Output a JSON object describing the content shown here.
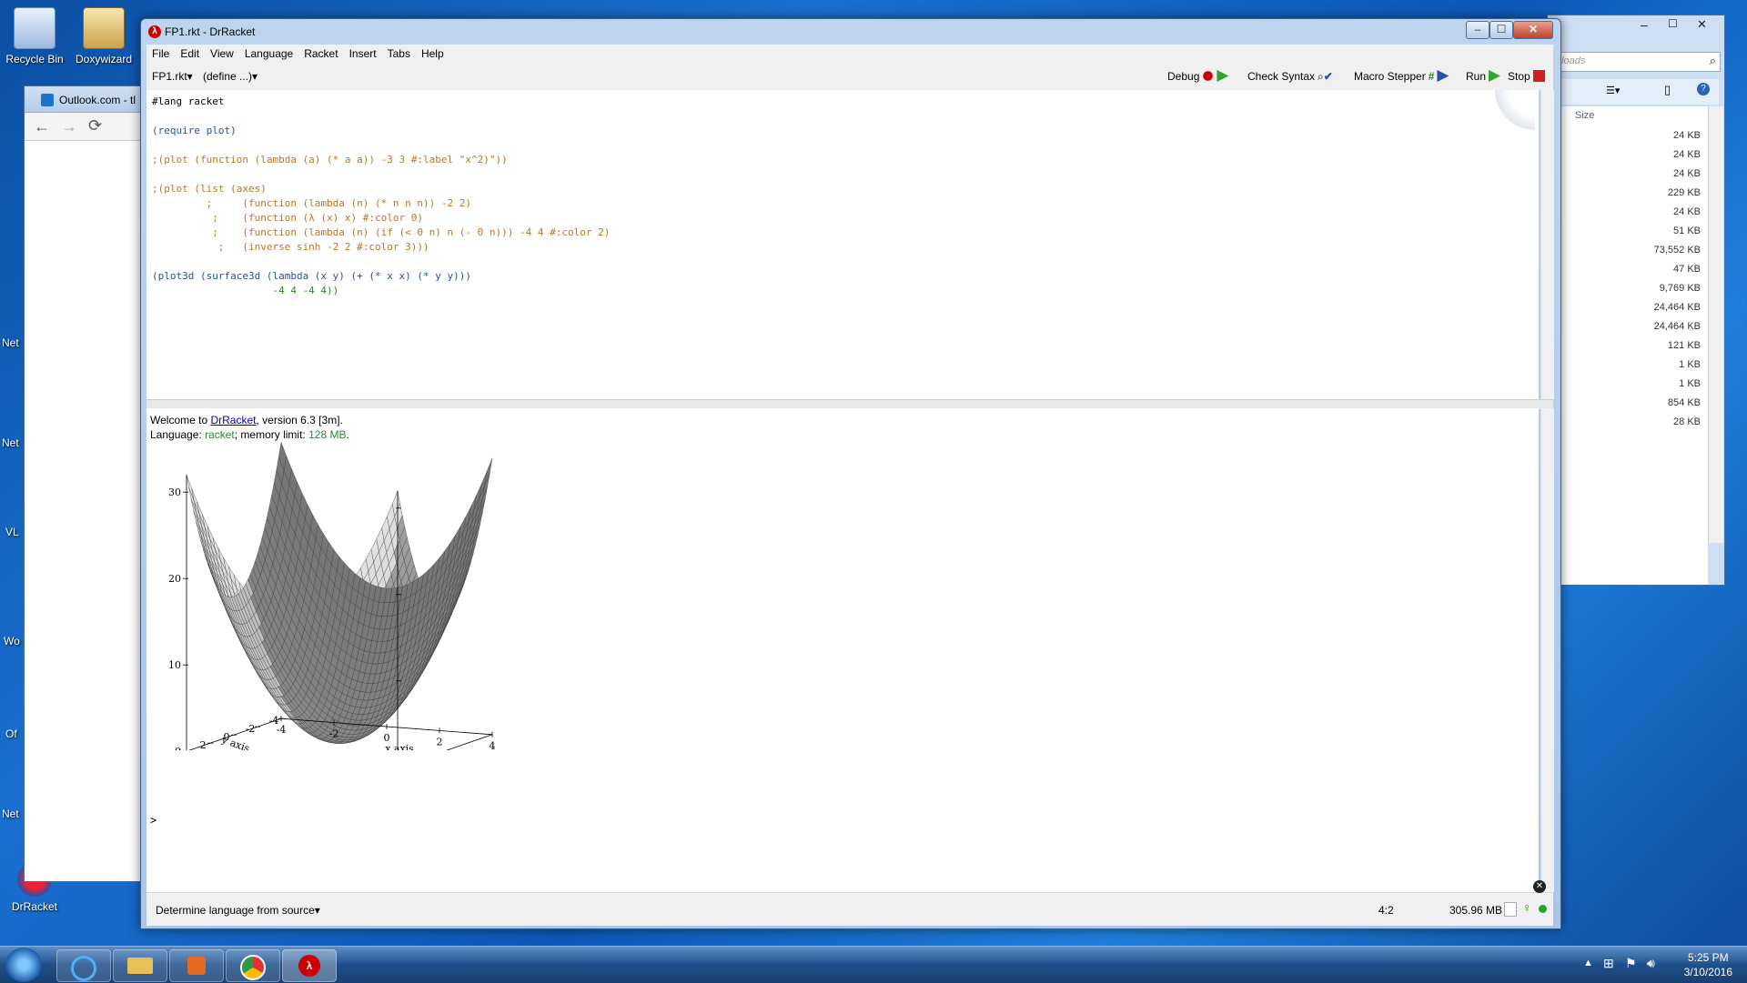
{
  "desktop_icons": [
    {
      "label": "Recycle Bin"
    },
    {
      "label": "Doxywizard"
    },
    {
      "label": "DrRacket"
    }
  ],
  "left_fragments": [
    "Net",
    "Net",
    "VL",
    "Wo",
    "Of",
    "Net"
  ],
  "browser": {
    "tab_title": "Outlook.com - tl"
  },
  "explorer": {
    "search_placeholder": "nloads",
    "size_header": "Size",
    "sizes": [
      "24 KB",
      "24 KB",
      "24 KB",
      "229 KB",
      "24 KB",
      "51 KB",
      "73,552 KB",
      "47 KB",
      "9,769 KB",
      "24,464 KB",
      "24,464 KB",
      "121 KB",
      "1 KB",
      "1 KB",
      "854 KB",
      "28 KB"
    ]
  },
  "window": {
    "title": "FP1.rkt - DrRacket",
    "min": "–",
    "max": "☐",
    "close": "✕"
  },
  "menu": [
    "File",
    "Edit",
    "View",
    "Language",
    "Racket",
    "Insert",
    "Tabs",
    "Help"
  ],
  "toolbar": {
    "file_dropdown": "FP1.rkt",
    "define_dropdown": "(define ...)",
    "debug": "Debug",
    "check_syntax": "Check Syntax",
    "macro_stepper": "Macro Stepper",
    "run": "Run",
    "stop": "Stop"
  },
  "editor": {
    "lines": [
      {
        "text": "#lang racket",
        "color": "#000000"
      },
      {
        "text": "",
        "color": "#000000"
      },
      {
        "text": "(require plot)",
        "color": "#2a4fa8"
      },
      {
        "text": "",
        "color": "#000000"
      },
      {
        "text": ";(plot (function (lambda (a) (* a a)) -3 3 #:label \"x^2)\"))",
        "color": "#c2741f"
      },
      {
        "text": "",
        "color": "#000000"
      },
      {
        "text": ";(plot (list (axes)",
        "color": "#c2741f"
      },
      {
        "text": "         ;     (function (lambda (n) (* n n n)) -2 2)",
        "color": "#c2741f"
      },
      {
        "text": "          ;    (function (λ (x) x) #:color 0)",
        "color": "#c2741f"
      },
      {
        "text": "          ;    (function (lambda (n) (if (< 0 n) n (- 0 n))) -4 4 #:color 2)",
        "color": "#c2741f"
      },
      {
        "text": "           ;   (inverse sinh -2 2 #:color 3)))",
        "color": "#c2741f"
      },
      {
        "text": "",
        "color": "#000000"
      },
      {
        "text": "(plot3d (surface3d (lambda (x y) (+ (* x x) (* y y)))",
        "color": "#2a4fa8"
      },
      {
        "text": "                    -4 4 -4 4))",
        "color": "#2a8a2a"
      }
    ]
  },
  "repl": {
    "welcome_prefix": "Welcome to ",
    "welcome_link": "DrRacket",
    "welcome_suffix": ", version 6.3 [3m].",
    "lang_prefix": "Language: ",
    "lang_name": "racket",
    "mem_prefix": "; memory limit: ",
    "mem_value": "128 MB",
    "mem_suffix": ".",
    "prompt": ">"
  },
  "plot": {
    "z_ticks": [
      "30",
      "20",
      "10",
      "0"
    ],
    "x_ticks": [
      "-4",
      "-2",
      "0",
      "2",
      "4"
    ],
    "y_ticks": [
      "4",
      "2",
      "0",
      "-2",
      "-4"
    ],
    "xlabel": "x axis",
    "ylabel": "y axis"
  },
  "status": {
    "language_select": "Determine language from source",
    "position": "4:2",
    "memory": "305.96 MB"
  },
  "taskbar": {
    "time": "5:25 PM",
    "date": "3/10/2016"
  },
  "colors": {
    "keyword_blue": "#2a4fa8",
    "comment_orange": "#c2741f",
    "literal_green": "#2a8a2a",
    "stop_red": "#d21f1f",
    "run_green": "#2fa52f"
  }
}
